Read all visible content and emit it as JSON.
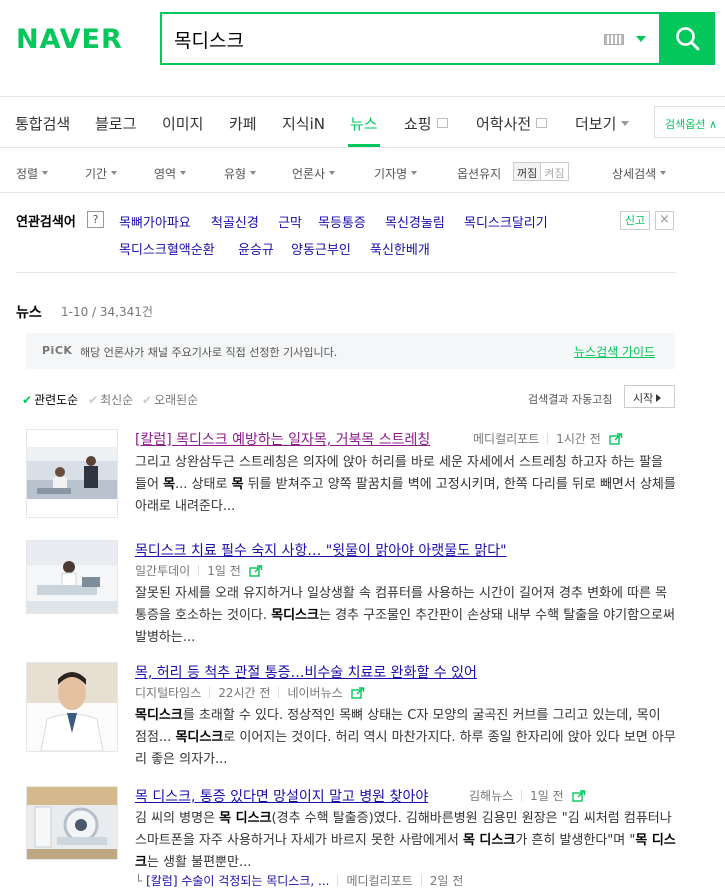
{
  "header": {
    "logo": "NAVER",
    "query": "목디스크"
  },
  "tabs": [
    {
      "label": "통합검색"
    },
    {
      "label": "블로그"
    },
    {
      "label": "이미지"
    },
    {
      "label": "카페"
    },
    {
      "label": "지식iN"
    },
    {
      "label": "뉴스"
    },
    {
      "label": "쇼핑"
    },
    {
      "label": "어학사전"
    },
    {
      "label": "더보기"
    }
  ],
  "search_options_label": "검색옵션",
  "filters": {
    "sort": "정렬",
    "period": "기간",
    "area": "영역",
    "type": "유형",
    "press": "언론사",
    "reporter": "기자명",
    "option_keep": "옵션유지",
    "toggle_off": "꺼짐",
    "toggle_on": "켜짐",
    "detail": "상세검색"
  },
  "related": {
    "label": "연관검색어",
    "help": "?",
    "keywords": [
      "목뼈가아파요",
      "척골신경",
      "근막",
      "목등통증",
      "목신경눌림",
      "목디스크달리기",
      "목디스크혈액순환",
      "윤승규",
      "양동근부인",
      "푹신한베개"
    ],
    "report": "신고",
    "close": "×"
  },
  "news": {
    "title": "뉴스",
    "count": "1-10 / 34,341건",
    "pick_badge": "PiCK",
    "pick_text": "해당 언론사가 채널 주요기사로 직접 선정한 기사입니다.",
    "pick_guide": "뉴스검색 가이드"
  },
  "sort": {
    "relevance": "관련도순",
    "latest": "최신순",
    "oldest": "오래된순",
    "auto_refresh": "검색결과 자동고침",
    "start": "시작"
  },
  "results": [
    {
      "title": "[칼럼] 목디스크 예방하는 일자목, 거북목 스트레칭",
      "press": "메디컬리포트",
      "time": "1시간 전",
      "body_html": "그리고 상완삼두근 스트레칭은 의자에 앉아 허리를 바로 세운 자세에서 스트레칭 하고자 하는 팔을 들어 <b>목</b>... 상태로 <b>목</b> 뒤를 받쳐주고 양쪽 팔꿈치를 벽에 고정시키며, 한쪽 다리를 뒤로 빼면서 상체를 아래로 내려준다..."
    },
    {
      "title": "목디스크 치료 필수 숙지 사항… \"윗물이 맑아야 아랫물도 맑다\"",
      "press": "일간투데이",
      "time": "1일 전",
      "body_html": "잘못된 자세를 오래 유지하거나 일상생활 속 컴퓨터를 사용하는 시간이 길어져 경추 변화에 따른 목 통증을 호소하는 것이다. <b>목디스크</b>는 경추 구조물인 추간판이 손상돼 내부 수핵 탈출을 야기함으로써 발병하는..."
    },
    {
      "title": "목, 허리 등 척추 관절 통증…비수술 치료로 완화할 수 있어",
      "press": "디지털타임스",
      "time": "22시간 전",
      "extra": "네이버뉴스",
      "body_html": "<b>목디스크</b>를 초래할 수 있다. 정상적인 목뼈 상태는 C자 모양의 굴곡진 커브를 그리고 있는데, 목이 점점... <b>목디스크</b>로 이어지는 것이다. 허리 역시 마찬가지다. 하루 종일 한자리에 앉아 있다 보면 아무리 좋은 의자가..."
    },
    {
      "title": "목 디스크, 통증 있다면 망설이지 말고 병원 찾아야",
      "press": "김해뉴스",
      "time": "1일 전",
      "body_html": "김 씨의 병명은 <b>목 디스크</b>(경추 수핵 탈출증)였다. 김해바른병원 김용민 원장은 \"김 씨처럼 컴퓨터나 스마트폰을 자주 사용하거나 자세가 바르지 못한 사람에게서 <b>목 디스크</b>가 흔히 발생한다\"며 \"<b>목 디스크</b>는 생활 불편뿐만...",
      "sub_link": "[칼럼] 수술이 걱정되는 목디스크, ...",
      "sub_press": "메디컬리포트",
      "sub_time": "2일 전"
    }
  ]
}
